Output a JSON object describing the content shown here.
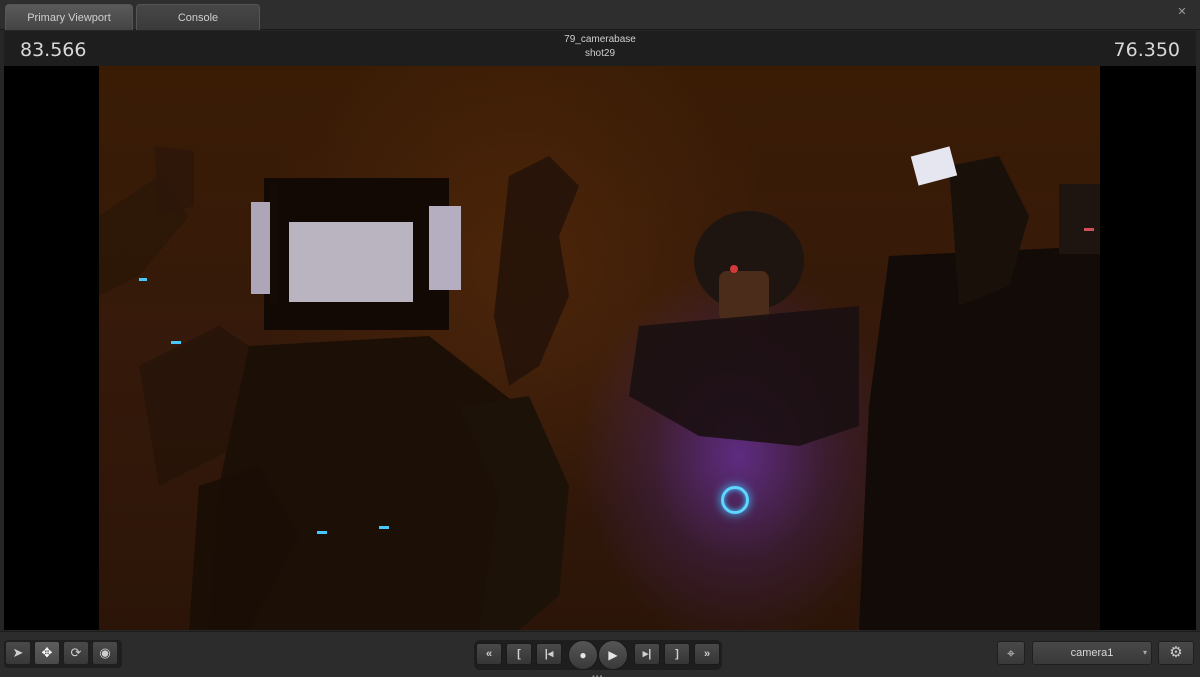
{
  "tabs": [
    {
      "label": "Primary Viewport",
      "active": true
    },
    {
      "label": "Console",
      "active": false
    }
  ],
  "tab_close_icon": "close-icon",
  "header": {
    "left_value": "83.566",
    "right_value": "76.350",
    "title_line1": "79_camerabase",
    "title_line2": "shot29"
  },
  "tools": [
    {
      "name": "select-tool",
      "icon": "arrow-pointer-icon",
      "glyph": "➤"
    },
    {
      "name": "move-tool",
      "icon": "move-arrows-icon",
      "glyph": "✥"
    },
    {
      "name": "rotate-tool",
      "icon": "rotate-icon",
      "glyph": "⟳"
    },
    {
      "name": "scale-tool",
      "icon": "target-circle-icon",
      "glyph": "◉"
    }
  ],
  "transport": {
    "rewind": "«",
    "mark_in": "[",
    "prev_frame": "|◂",
    "record": "●",
    "play": "▶",
    "next_frame": "▸|",
    "mark_out": "]",
    "fast_forward": "»"
  },
  "camera": {
    "selected": "camera1",
    "caret": "▾"
  },
  "icons": {
    "crosshair": "⌖",
    "gear": "⚙"
  },
  "grip": "•••"
}
